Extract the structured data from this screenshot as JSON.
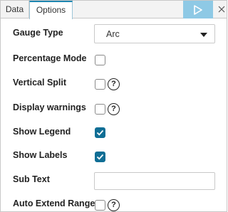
{
  "tabs": {
    "data_label": "Data",
    "options_label": "Options",
    "active": "Options"
  },
  "toolbar": {
    "run_icon": "play-icon",
    "close_icon": "close-icon"
  },
  "options": {
    "gauge_type": {
      "label": "Gauge Type",
      "value": "Arc"
    },
    "percentage_mode": {
      "label": "Percentage Mode",
      "checked": false
    },
    "vertical_split": {
      "label": "Vertical Split",
      "checked": false,
      "help": "?"
    },
    "display_warnings": {
      "label": "Display warnings",
      "checked": false,
      "help": "?"
    },
    "show_legend": {
      "label": "Show Legend",
      "checked": true
    },
    "show_labels": {
      "label": "Show Labels",
      "checked": true
    },
    "sub_text": {
      "label": "Sub Text",
      "value": "",
      "placeholder": ""
    },
    "auto_extend_range": {
      "label": "Auto Extend Range",
      "checked": false,
      "help": "?"
    }
  },
  "colors": {
    "accent": "#106e95",
    "run_button": "#8ec9e5",
    "active_tab_border": "#1e86b0"
  }
}
